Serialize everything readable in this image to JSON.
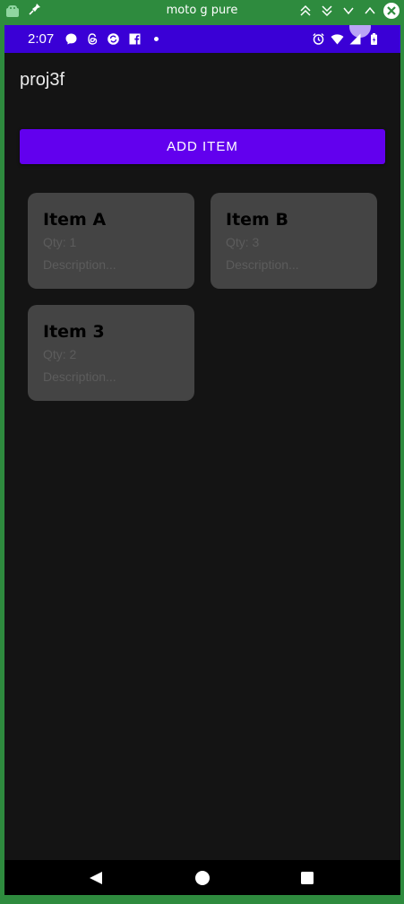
{
  "window": {
    "title": "moto g pure"
  },
  "status_bar": {
    "time": "2:07"
  },
  "app": {
    "title": "proj3f",
    "add_button_label": "ADD ITEM"
  },
  "items": [
    {
      "name": "Item A",
      "qty": "Qty: 1",
      "description": "Description..."
    },
    {
      "name": "Item B",
      "qty": "Qty: 3",
      "description": "Description..."
    },
    {
      "name": "Item 3",
      "qty": "Qty: 2",
      "description": "Description..."
    }
  ],
  "colors": {
    "window_frame": "#2e8b3e",
    "status_bar": "#3a00d6",
    "background": "#141414",
    "primary_button": "#6200ee",
    "card": "#444444"
  },
  "icons": {
    "window": [
      "emulator-app-icon",
      "pin-icon",
      "double-chevron-up-icon",
      "double-chevron-down-icon",
      "chevron-down-icon",
      "chevron-up-icon",
      "close-icon"
    ],
    "status_bar": [
      "messenger-icon",
      "threads-icon",
      "sync-icon",
      "facebook-icon",
      "notification-dot",
      "alarm-icon",
      "wifi-icon",
      "signal-icon",
      "battery-icon"
    ],
    "navigation": [
      "back-icon",
      "home-icon",
      "recents-icon"
    ]
  }
}
